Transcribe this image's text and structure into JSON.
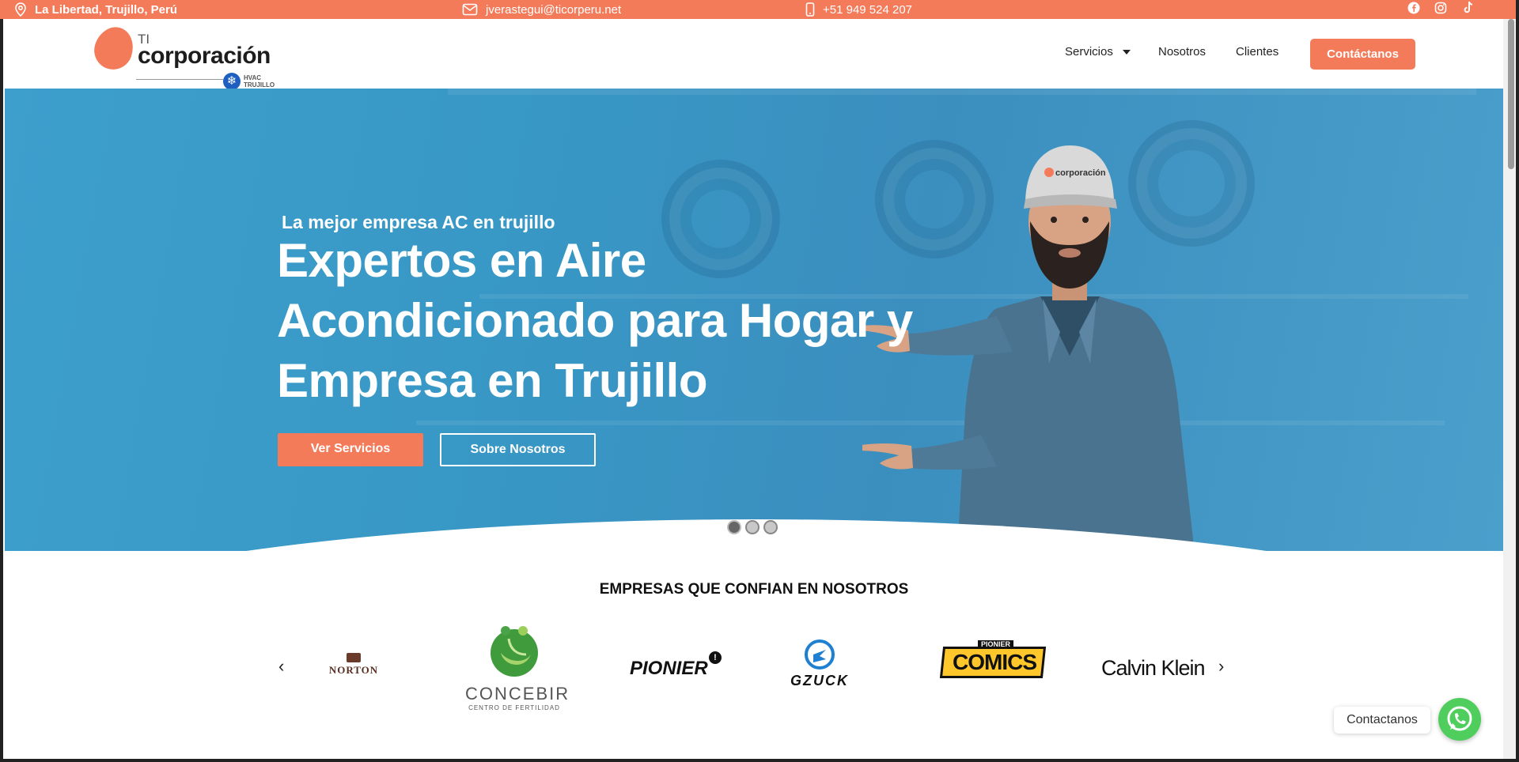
{
  "topbar": {
    "location": "La Libertad, Trujillo, Perú",
    "email": "jverastegui@ticorperu.net",
    "phone": "+51 949 524 207",
    "social": [
      "facebook-icon",
      "instagram-icon",
      "tiktok-icon"
    ]
  },
  "logo": {
    "prefix": "TI",
    "name": "corporación",
    "tag_line1": "HVAC",
    "tag_line2": "TRUJILLO"
  },
  "nav": {
    "items": [
      "Servicios",
      "Nosotros",
      "Clientes"
    ],
    "cta": "Contáctanos"
  },
  "hero": {
    "subtitle": "La mejor empresa AC en trujillo",
    "headline": "Expertos en Aire Acondicionado para Hogar y Empresa en Trujillo",
    "primary_button": "Ver Servicios",
    "secondary_button": "Sobre Nosotros",
    "slides": 3,
    "active_slide": 1,
    "cap_text": "corporación"
  },
  "clients": {
    "title": "EMPRESAS QUE CONFIAN EN NOSOTROS",
    "logos": [
      "NORTON",
      "CONCEBIR",
      "PIONIER",
      "GZUCK",
      "COMICS",
      "Calvin Klein"
    ],
    "concebir_sub": "CENTRO DE FERTILIDAD",
    "comics_top": "PIONIER"
  },
  "whatsapp": {
    "label": "Contactanos"
  },
  "colors": {
    "accent": "#f47b5a",
    "hero_blue": "#3d9fcc",
    "whatsapp": "#4fce5d"
  }
}
